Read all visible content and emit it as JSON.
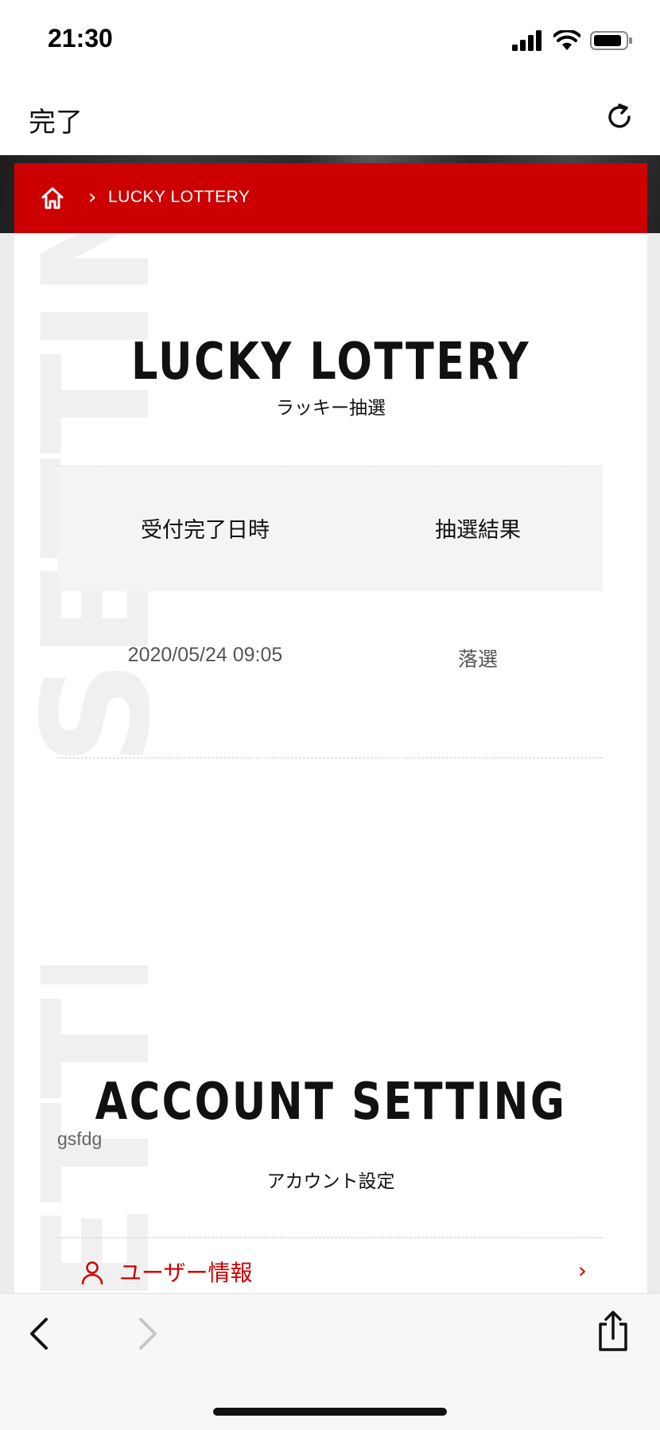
{
  "status_bar": {
    "time": "21:30"
  },
  "browser": {
    "done_label": "完了"
  },
  "breadcrumb": {
    "current": "LUCKY LOTTERY"
  },
  "watermark": {
    "text": "SETTING"
  },
  "lottery": {
    "title": "LUCKY LOTTERY",
    "subtitle": "ラッキー抽選",
    "columns": [
      "受付完了日時",
      "抽選結果"
    ],
    "rows": [
      {
        "date": "2020/05/24 09:05",
        "result": "落選"
      }
    ]
  },
  "account": {
    "title": "ACCOUNT SETTING",
    "name": "gsfdg",
    "subtitle": "アカウント設定",
    "menu": [
      {
        "label": "ユーザー情報"
      }
    ]
  },
  "colors": {
    "accent": "#cc0000",
    "panel_bg": "#ffffff",
    "page_bg": "#f1f1f1",
    "header_bg": "#f4f4f4"
  },
  "icons": {
    "status": [
      "signal-icon",
      "wifi-icon",
      "battery-icon"
    ],
    "browser": [
      "reload-icon"
    ],
    "toolbar": [
      "back-arrow-icon",
      "forward-arrow-icon",
      "share-icon"
    ],
    "page": [
      "home-icon",
      "user-icon",
      "chevron-right-icon",
      "chevron-up-icon"
    ]
  }
}
